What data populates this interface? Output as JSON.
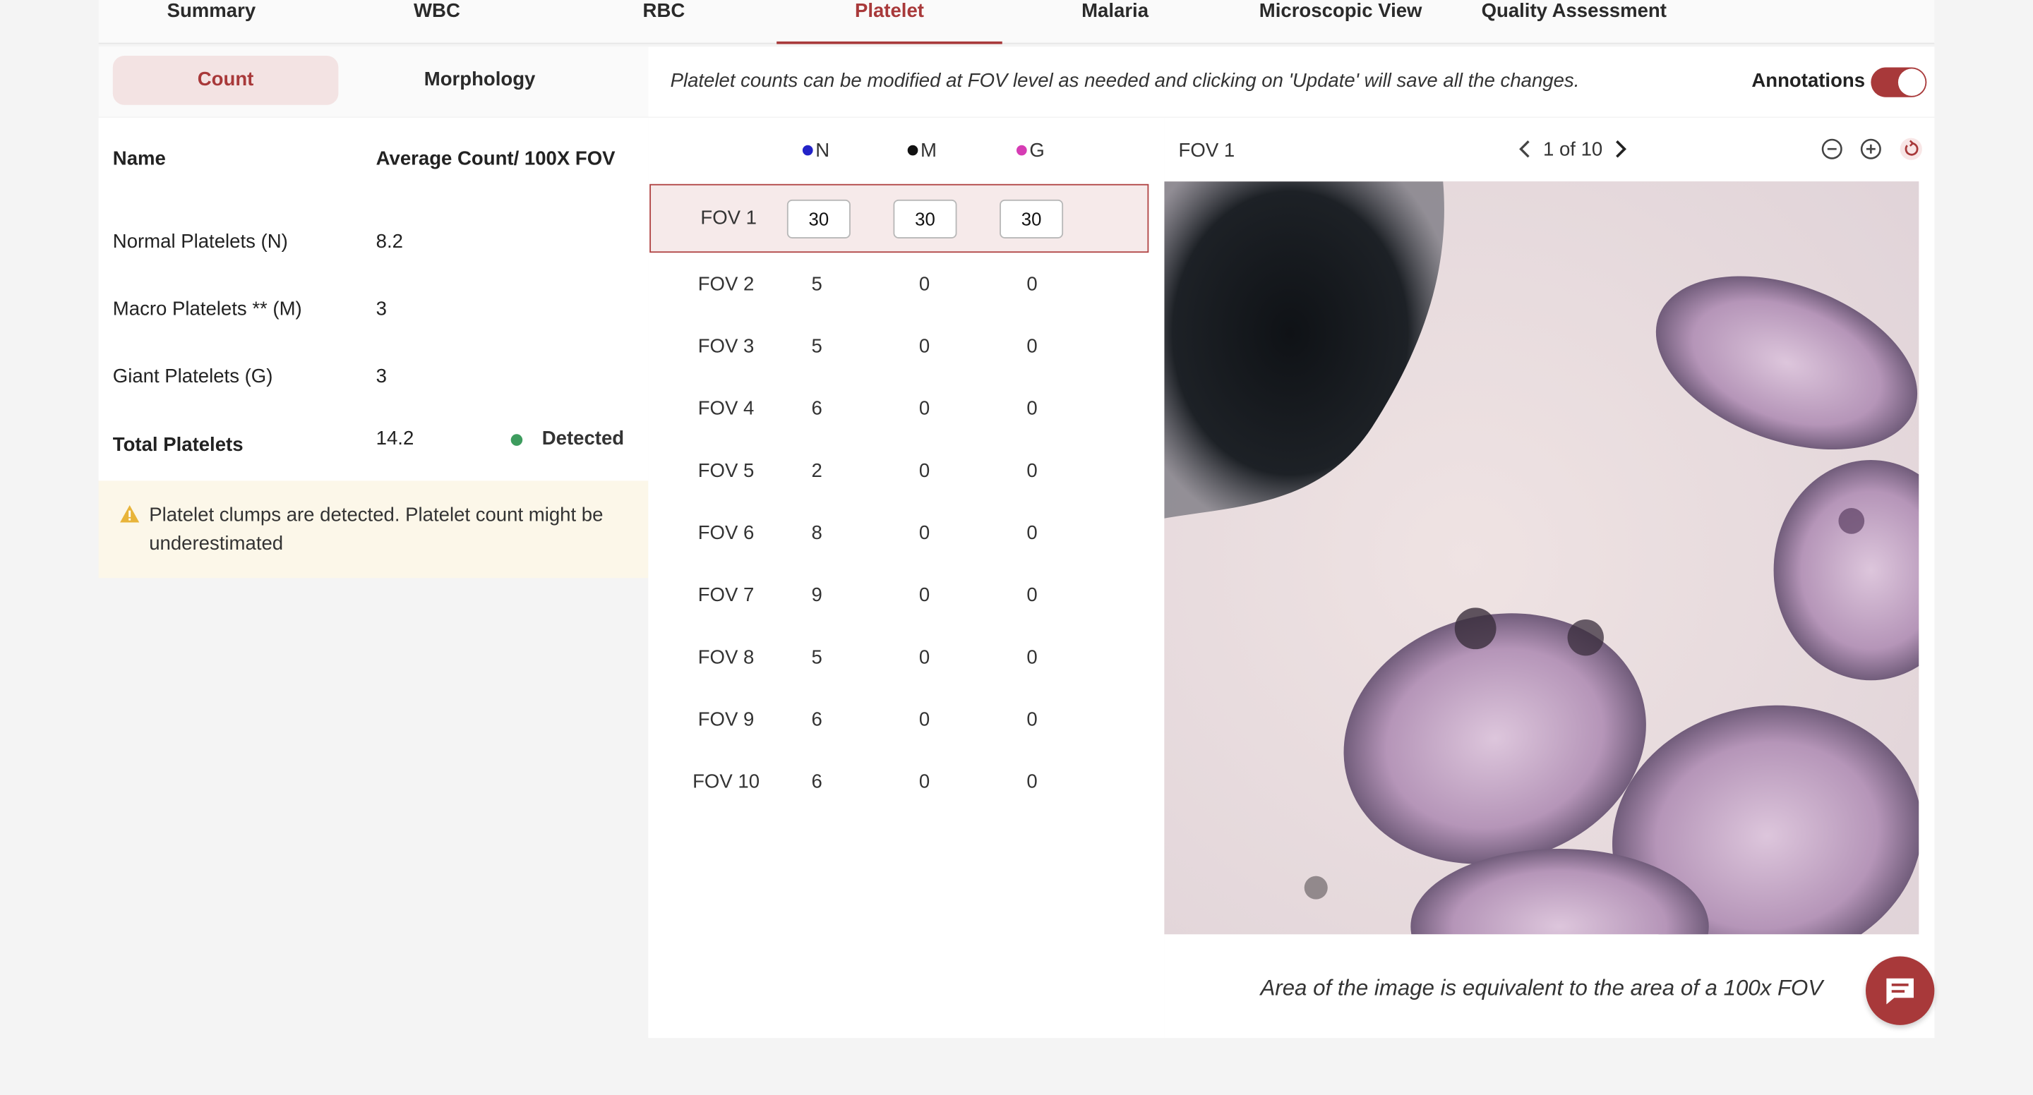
{
  "tabs": [
    {
      "label": "Summary"
    },
    {
      "label": "WBC"
    },
    {
      "label": "RBC"
    },
    {
      "label": "Platelet",
      "active": true
    },
    {
      "label": "Malaria"
    },
    {
      "label": "Microscopic View"
    },
    {
      "label": "Quality Assessment"
    }
  ],
  "subtabs": [
    {
      "label": "Count",
      "active": true
    },
    {
      "label": "Morphology"
    }
  ],
  "summary": {
    "header_name": "Name",
    "header_value": "Average Count/ 100X FOV",
    "rows": [
      {
        "name": "Normal Platelets (N)",
        "value": "8.2"
      },
      {
        "name": "Macro Platelets ** (M)",
        "value": "3"
      },
      {
        "name": "Giant Platelets (G)",
        "value": "3"
      }
    ],
    "total_label": "Total Platelets",
    "total_value": "14.2",
    "detected_label": "Detected",
    "detected_color": "#3d9c5e"
  },
  "warning": {
    "icon": "warning-triangle-icon",
    "text": "Platelet clumps are detected. Platelet count might be underestimated"
  },
  "infobar": {
    "text": "Platelet counts can be modified at FOV level as needed and clicking on 'Update' will save all the changes.",
    "annotations_label": "Annotations",
    "annotations_on": true
  },
  "fov_table": {
    "columns": [
      {
        "label": "N",
        "color": "#2323c8"
      },
      {
        "label": "M",
        "color": "#111111"
      },
      {
        "label": "G",
        "color": "#d63cb4"
      }
    ],
    "rows": [
      {
        "name": "FOV 1",
        "n": "30",
        "m": "30",
        "g": "30",
        "editing": true
      },
      {
        "name": "FOV 2",
        "n": "5",
        "m": "0",
        "g": "0"
      },
      {
        "name": "FOV 3",
        "n": "5",
        "m": "0",
        "g": "0"
      },
      {
        "name": "FOV 4",
        "n": "6",
        "m": "0",
        "g": "0"
      },
      {
        "name": "FOV 5",
        "n": "2",
        "m": "0",
        "g": "0"
      },
      {
        "name": "FOV 6",
        "n": "8",
        "m": "0",
        "g": "0"
      },
      {
        "name": "FOV 7",
        "n": "9",
        "m": "0",
        "g": "0"
      },
      {
        "name": "FOV 8",
        "n": "5",
        "m": "0",
        "g": "0"
      },
      {
        "name": "FOV 9",
        "n": "6",
        "m": "0",
        "g": "0"
      },
      {
        "name": "FOV 10",
        "n": "6",
        "m": "0",
        "g": "0"
      }
    ]
  },
  "viewer": {
    "fov_label": "FOV 1",
    "pager_text": "1 of 10",
    "caption": "Area of the image is equivalent to the area of a 100x FOV"
  },
  "colors": {
    "accent": "#a8393a",
    "selected_row_bg": "#f6eaea",
    "warning_bg": "#fcf7e9",
    "warning_icon": "#e8b43a"
  }
}
